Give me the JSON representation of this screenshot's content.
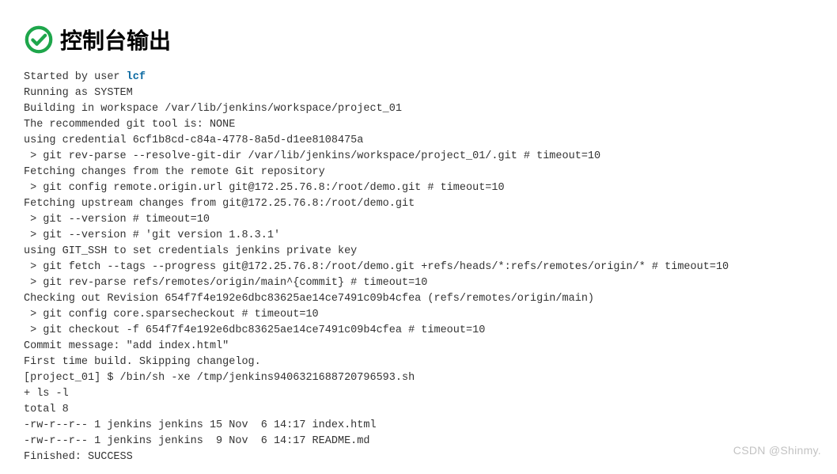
{
  "header": {
    "icon": "check-circle-icon",
    "title": "控制台输出"
  },
  "user_link": {
    "prefix": "Started by user ",
    "label": "lcf"
  },
  "console_lines": [
    "Running as SYSTEM",
    "Building in workspace /var/lib/jenkins/workspace/project_01",
    "The recommended git tool is: NONE",
    "using credential 6cf1b8cd-c84a-4778-8a5d-d1ee8108475a",
    " > git rev-parse --resolve-git-dir /var/lib/jenkins/workspace/project_01/.git # timeout=10",
    "Fetching changes from the remote Git repository",
    " > git config remote.origin.url git@172.25.76.8:/root/demo.git # timeout=10",
    "Fetching upstream changes from git@172.25.76.8:/root/demo.git",
    " > git --version # timeout=10",
    " > git --version # 'git version 1.8.3.1'",
    "using GIT_SSH to set credentials jenkins private key",
    " > git fetch --tags --progress git@172.25.76.8:/root/demo.git +refs/heads/*:refs/remotes/origin/* # timeout=10",
    " > git rev-parse refs/remotes/origin/main^{commit} # timeout=10",
    "Checking out Revision 654f7f4e192e6dbc83625ae14ce7491c09b4cfea (refs/remotes/origin/main)",
    " > git config core.sparsecheckout # timeout=10",
    " > git checkout -f 654f7f4e192e6dbc83625ae14ce7491c09b4cfea # timeout=10",
    "Commit message: \"add index.html\"",
    "First time build. Skipping changelog.",
    "[project_01] $ /bin/sh -xe /tmp/jenkins9406321688720796593.sh",
    "+ ls -l",
    "total 8",
    "-rw-r--r-- 1 jenkins jenkins 15 Nov  6 14:17 index.html",
    "-rw-r--r-- 1 jenkins jenkins  9 Nov  6 14:17 README.md",
    "Finished: SUCCESS"
  ],
  "watermark": "CSDN @Shinmy."
}
